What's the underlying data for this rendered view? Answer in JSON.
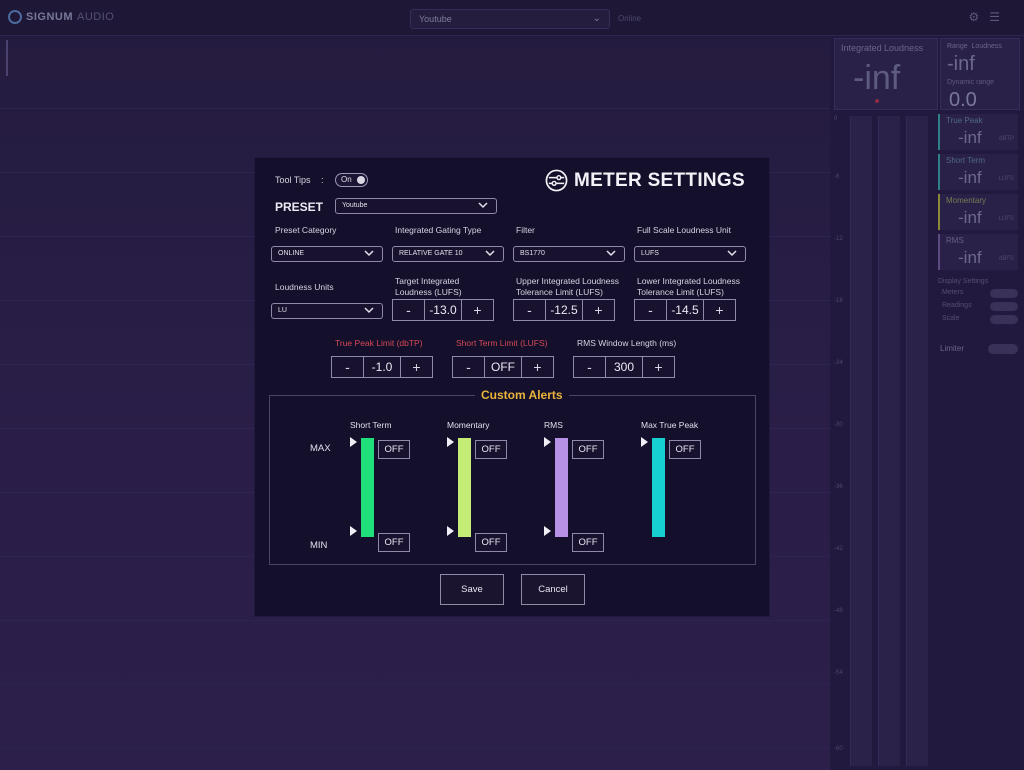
{
  "app": {
    "logo_brand": "SIGNUM",
    "logo_sub": "AUDIO",
    "preset_value": "Youtube",
    "preset_category_hint": "Online",
    "integrated_loudness_label": "Integrated Loudness",
    "integrated_loudness_value": "-inf",
    "range_label": "Range",
    "range_unit_label": "Loudness",
    "range_value": "-inf",
    "dynamic_range_label": "Dynamic range",
    "dynamic_range_value": "0.0",
    "side_meters": [
      {
        "label": "True Peak",
        "value": "-inf",
        "unit": "dBTP"
      },
      {
        "label": "Short Term",
        "value": "-inf",
        "unit": "LUFS"
      },
      {
        "label": "Momentary",
        "value": "-inf",
        "unit": "LUFS"
      },
      {
        "label": "RMS",
        "value": "-inf",
        "unit": "dBFS"
      }
    ],
    "display_settings_label": "Display Settings",
    "display_rows": [
      "Meters",
      "Readings",
      "Scale"
    ],
    "limiter_label": "Limiter",
    "scale_ticks": [
      "0",
      "-6",
      "-12",
      "-18",
      "-24",
      "-30",
      "-36",
      "-42",
      "-48",
      "-54",
      "-60"
    ]
  },
  "modal": {
    "tooltips_label": "Tool Tips",
    "tooltips_colon": ":",
    "tooltips_state": "On",
    "title": "METER SETTINGS",
    "preset_label": "PRESET",
    "preset_value": "Youtube",
    "preset_category": {
      "label": "Preset Category",
      "value": "ONLINE"
    },
    "gating_type": {
      "label": "Integrated Gating Type",
      "value": "RELATIVE GATE 10"
    },
    "filter": {
      "label": "Filter",
      "value": "BS1770"
    },
    "full_scale_unit": {
      "label": "Full Scale Loudness Unit",
      "value": "LUFS"
    },
    "loudness_units": {
      "label": "Loudness Units",
      "value": "LU"
    },
    "target_integrated": {
      "label_line1": "Target Integrated",
      "label_line2": "Loudness (LUFS)",
      "value": "-13.0"
    },
    "upper_tolerance": {
      "label_line1": "Upper Integrated Loudness",
      "label_line2": "Tolerance Limit (LUFS)",
      "value": "-12.5"
    },
    "lower_tolerance": {
      "label_line1": "Lower Integrated Loudness",
      "label_line2": "Tolerance Limit (LUFS)",
      "value": "-14.5"
    },
    "true_peak_limit": {
      "label": "True Peak Limit (dbTP)",
      "value": "-1.0"
    },
    "short_term_limit": {
      "label": "Short Term Limit (LUFS)",
      "value": "OFF"
    },
    "rms_window": {
      "label": "RMS Window Length (ms)",
      "value": "300"
    },
    "minus": "-",
    "plus": "+",
    "alerts": {
      "title": "Custom Alerts",
      "max_label": "MAX",
      "min_label": "MIN",
      "columns": [
        {
          "label": "Short Term",
          "color": "#1fe07a",
          "max_value": "OFF",
          "min_value": "OFF"
        },
        {
          "label": "Momentary",
          "color": "#c6ec78",
          "max_value": "OFF",
          "min_value": "OFF"
        },
        {
          "label": "RMS",
          "color": "#b691e6",
          "max_value": "OFF",
          "min_value": "OFF"
        },
        {
          "label": "Max True Peak",
          "color": "#16cfcf",
          "max_value": "OFF"
        }
      ]
    },
    "save_label": "Save",
    "cancel_label": "Cancel"
  }
}
